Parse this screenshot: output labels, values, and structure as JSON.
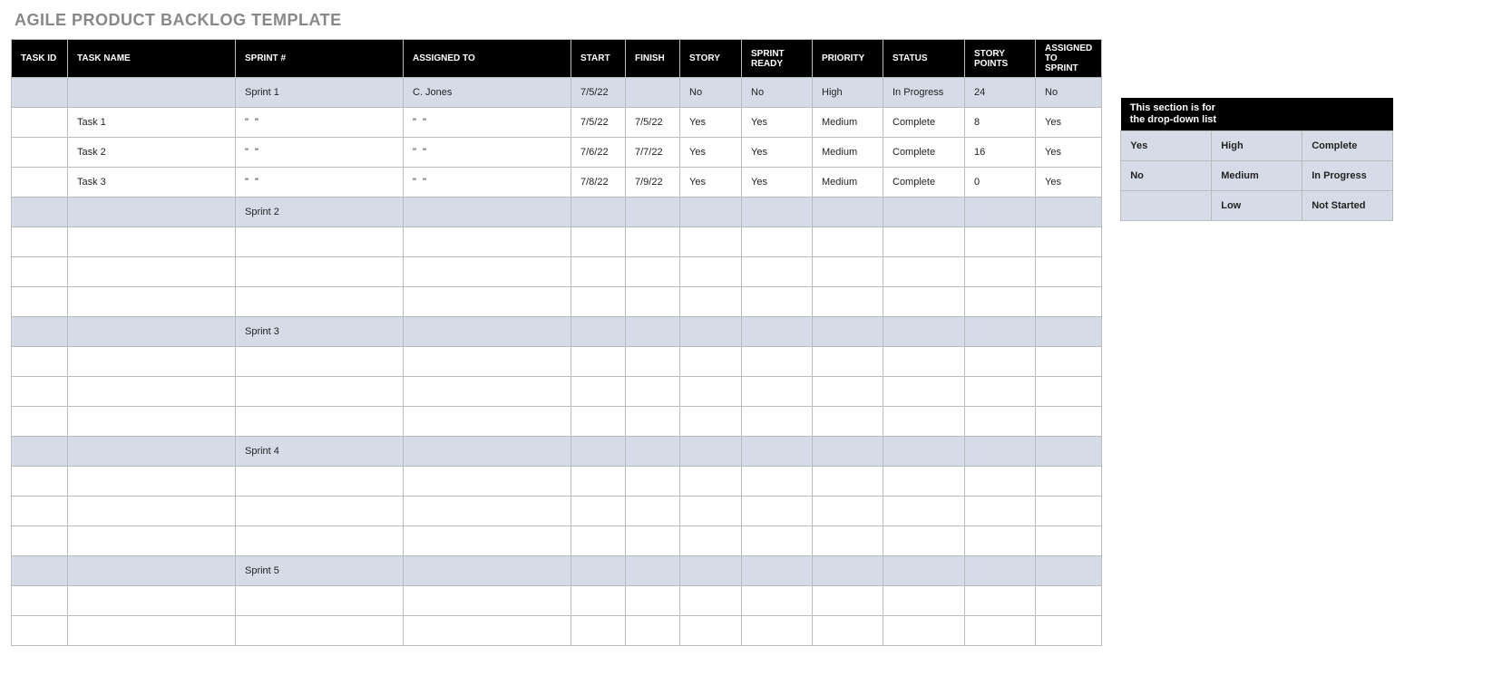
{
  "title": "AGILE PRODUCT BACKLOG TEMPLATE",
  "headers": {
    "task_id": "TASK ID",
    "task_name": "TASK NAME",
    "sprint": "SPRINT #",
    "assigned_to": "ASSIGNED TO",
    "start": "START",
    "finish": "FINISH",
    "story": "STORY",
    "sprint_ready": "SPRINT READY",
    "priority": "PRIORITY",
    "status": "STATUS",
    "story_points": "STORY POINTS",
    "assigned_to_sprint": "ASSIGNED TO SPRINT"
  },
  "rows": [
    {
      "type": "sprint",
      "task_id": "",
      "task_name": "",
      "sprint": "Sprint 1",
      "assigned_to": "C. Jones",
      "start": "7/5/22",
      "finish": "",
      "story": "No",
      "sprint_ready": "No",
      "priority": "High",
      "status": "In Progress",
      "story_points": "24",
      "assigned_to_sprint": "No"
    },
    {
      "type": "task",
      "task_id": "",
      "task_name": "Task 1",
      "sprint": "\" \"",
      "assigned_to": "\" \"",
      "start": "7/5/22",
      "finish": "7/5/22",
      "story": "Yes",
      "sprint_ready": "Yes",
      "priority": "Medium",
      "status": "Complete",
      "story_points": "8",
      "assigned_to_sprint": "Yes"
    },
    {
      "type": "task",
      "task_id": "",
      "task_name": "Task 2",
      "sprint": "\" \"",
      "assigned_to": "\" \"",
      "start": "7/6/22",
      "finish": "7/7/22",
      "story": "Yes",
      "sprint_ready": "Yes",
      "priority": "Medium",
      "status": "Complete",
      "story_points": "16",
      "assigned_to_sprint": "Yes"
    },
    {
      "type": "task",
      "task_id": "",
      "task_name": "Task 3",
      "sprint": "\" \"",
      "assigned_to": "\" \"",
      "start": "7/8/22",
      "finish": "7/9/22",
      "story": "Yes",
      "sprint_ready": "Yes",
      "priority": "Medium",
      "status": "Complete",
      "story_points": "0",
      "assigned_to_sprint": "Yes"
    },
    {
      "type": "sprint",
      "task_id": "",
      "task_name": "",
      "sprint": "Sprint 2",
      "assigned_to": "",
      "start": "",
      "finish": "",
      "story": "",
      "sprint_ready": "",
      "priority": "",
      "status": "",
      "story_points": "",
      "assigned_to_sprint": ""
    },
    {
      "type": "task",
      "task_id": "",
      "task_name": "",
      "sprint": "",
      "assigned_to": "",
      "start": "",
      "finish": "",
      "story": "",
      "sprint_ready": "",
      "priority": "",
      "status": "",
      "story_points": "",
      "assigned_to_sprint": ""
    },
    {
      "type": "task",
      "task_id": "",
      "task_name": "",
      "sprint": "",
      "assigned_to": "",
      "start": "",
      "finish": "",
      "story": "",
      "sprint_ready": "",
      "priority": "",
      "status": "",
      "story_points": "",
      "assigned_to_sprint": ""
    },
    {
      "type": "task",
      "task_id": "",
      "task_name": "",
      "sprint": "",
      "assigned_to": "",
      "start": "",
      "finish": "",
      "story": "",
      "sprint_ready": "",
      "priority": "",
      "status": "",
      "story_points": "",
      "assigned_to_sprint": ""
    },
    {
      "type": "sprint",
      "task_id": "",
      "task_name": "",
      "sprint": "Sprint 3",
      "assigned_to": "",
      "start": "",
      "finish": "",
      "story": "",
      "sprint_ready": "",
      "priority": "",
      "status": "",
      "story_points": "",
      "assigned_to_sprint": ""
    },
    {
      "type": "task",
      "task_id": "",
      "task_name": "",
      "sprint": "",
      "assigned_to": "",
      "start": "",
      "finish": "",
      "story": "",
      "sprint_ready": "",
      "priority": "",
      "status": "",
      "story_points": "",
      "assigned_to_sprint": ""
    },
    {
      "type": "task",
      "task_id": "",
      "task_name": "",
      "sprint": "",
      "assigned_to": "",
      "start": "",
      "finish": "",
      "story": "",
      "sprint_ready": "",
      "priority": "",
      "status": "",
      "story_points": "",
      "assigned_to_sprint": ""
    },
    {
      "type": "task",
      "task_id": "",
      "task_name": "",
      "sprint": "",
      "assigned_to": "",
      "start": "",
      "finish": "",
      "story": "",
      "sprint_ready": "",
      "priority": "",
      "status": "",
      "story_points": "",
      "assigned_to_sprint": ""
    },
    {
      "type": "sprint",
      "task_id": "",
      "task_name": "",
      "sprint": "Sprint 4",
      "assigned_to": "",
      "start": "",
      "finish": "",
      "story": "",
      "sprint_ready": "",
      "priority": "",
      "status": "",
      "story_points": "",
      "assigned_to_sprint": ""
    },
    {
      "type": "task",
      "task_id": "",
      "task_name": "",
      "sprint": "",
      "assigned_to": "",
      "start": "",
      "finish": "",
      "story": "",
      "sprint_ready": "",
      "priority": "",
      "status": "",
      "story_points": "",
      "assigned_to_sprint": ""
    },
    {
      "type": "task",
      "task_id": "",
      "task_name": "",
      "sprint": "",
      "assigned_to": "",
      "start": "",
      "finish": "",
      "story": "",
      "sprint_ready": "",
      "priority": "",
      "status": "",
      "story_points": "",
      "assigned_to_sprint": ""
    },
    {
      "type": "task",
      "task_id": "",
      "task_name": "",
      "sprint": "",
      "assigned_to": "",
      "start": "",
      "finish": "",
      "story": "",
      "sprint_ready": "",
      "priority": "",
      "status": "",
      "story_points": "",
      "assigned_to_sprint": ""
    },
    {
      "type": "sprint",
      "task_id": "",
      "task_name": "",
      "sprint": "Sprint 5",
      "assigned_to": "",
      "start": "",
      "finish": "",
      "story": "",
      "sprint_ready": "",
      "priority": "",
      "status": "",
      "story_points": "",
      "assigned_to_sprint": ""
    },
    {
      "type": "task",
      "task_id": "",
      "task_name": "",
      "sprint": "",
      "assigned_to": "",
      "start": "",
      "finish": "",
      "story": "",
      "sprint_ready": "",
      "priority": "",
      "status": "",
      "story_points": "",
      "assigned_to_sprint": ""
    },
    {
      "type": "task",
      "task_id": "",
      "task_name": "",
      "sprint": "",
      "assigned_to": "",
      "start": "",
      "finish": "",
      "story": "",
      "sprint_ready": "",
      "priority": "",
      "status": "",
      "story_points": "",
      "assigned_to_sprint": ""
    }
  ],
  "dropdown": {
    "header_line1": "This section is for",
    "header_line2": "the drop-down list",
    "yes_no": [
      "Yes",
      "No",
      ""
    ],
    "priority": [
      "High",
      "Medium",
      "Low"
    ],
    "status": [
      "Complete",
      "In Progress",
      "Not Started"
    ]
  },
  "col_widths": {
    "task_id": 62,
    "task_name": 185,
    "sprint": 185,
    "assigned_to": 185,
    "start": 60,
    "finish": 60,
    "story": 68,
    "sprint_ready": 78,
    "priority": 78,
    "status": 90,
    "story_points": 78,
    "assigned_to_sprint": 62,
    "side_col": 100
  }
}
